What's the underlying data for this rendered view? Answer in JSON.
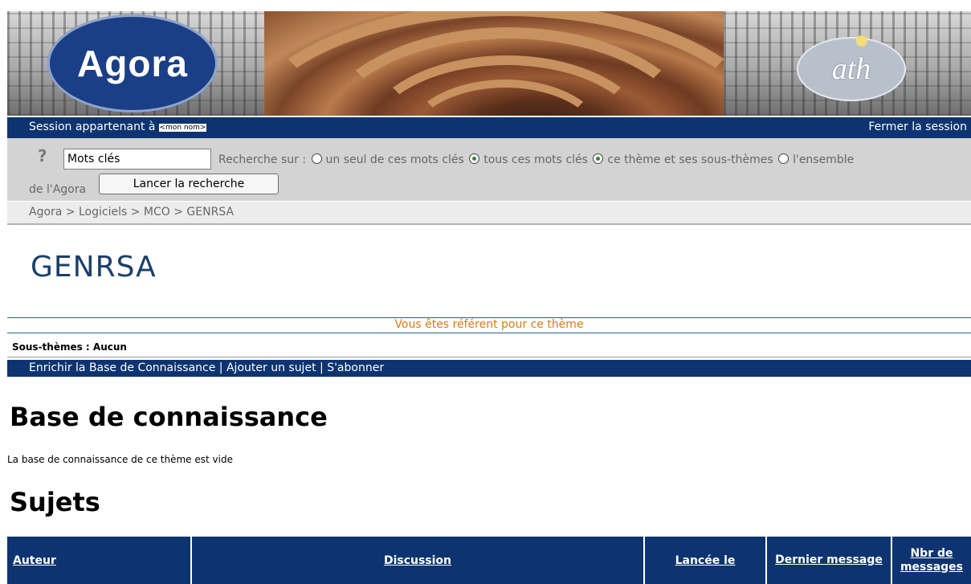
{
  "banner": {
    "logo_text": "Agora",
    "partner_logo_text": "ath"
  },
  "session": {
    "label": "Session appartenant à",
    "user_name": "<mon nom>",
    "logout_label": "Fermer la session"
  },
  "search": {
    "keywords_value": "Mots clés",
    "scope_label": "Recherche sur :",
    "options": [
      {
        "label": "un seul de ces mots clés",
        "selected": false
      },
      {
        "label": "tous ces mots clés",
        "selected": true
      },
      {
        "label": "ce thème et ses sous-thèmes",
        "selected": true
      },
      {
        "label": "l'ensemble",
        "selected": false
      }
    ],
    "options_continuation": "de l'Agora",
    "button_label": "Lancer la recherche"
  },
  "breadcrumb": "Agora > Logiciels > MCO > GENRSA",
  "theme": {
    "title": "GENRSA",
    "referent_notice": "Vous êtes référent pour ce thème",
    "subthemes": "Sous-thèmes : Aucun"
  },
  "actions": {
    "enrich": "Enrichir la Base de Connaissance",
    "separator": " | ",
    "add_topic": "Ajouter un sujet",
    "subscribe": "S'abonner"
  },
  "knowledge_base": {
    "heading": "Base de connaissance",
    "empty_message": "La base de connaissance de ce thème est vide"
  },
  "topics": {
    "heading": "Sujets",
    "columns": [
      "Auteur",
      "Discussion",
      "Lancée le",
      "Dernier message",
      "Nbr de messages"
    ]
  },
  "colors": {
    "navy_bar": "#0d3470",
    "notice_orange": "#dd7a10",
    "title_blue": "#1b3f6b"
  }
}
